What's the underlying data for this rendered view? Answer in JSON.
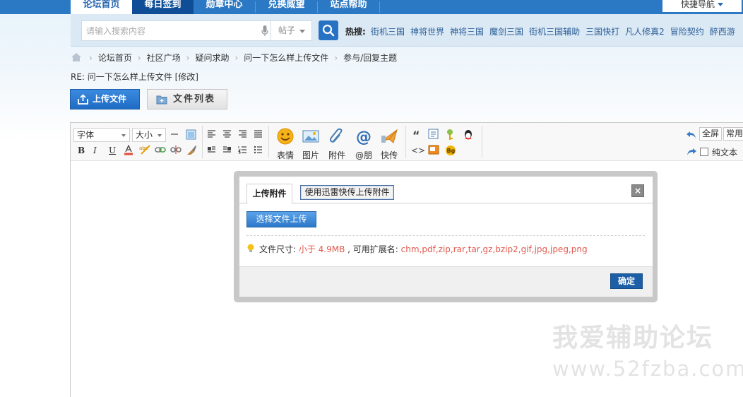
{
  "topnav": {
    "tabs": [
      "论坛首页",
      "每日签到",
      "勋章中心",
      "兑换威望",
      "站点帮助"
    ],
    "quick_nav": "快捷导航"
  },
  "search": {
    "placeholder": "请输入搜索内容",
    "type": "帖子",
    "hot_label": "热搜:",
    "hot_links": [
      "街机三国",
      "神将世界",
      "神将三国",
      "魔剑三国",
      "街机三国辅助",
      "三国快打",
      "凡人修真2",
      "冒险契约",
      "醉西游"
    ]
  },
  "breadcrumb": [
    "论坛首页",
    "社区广场",
    "疑问求助",
    "问一下怎么样上传文件",
    "参与/回复主题"
  ],
  "post_title": "RE: 问一下怎么样上传文件 [修改]",
  "buttons": {
    "upload": "上传文件",
    "file_list": "文件列表"
  },
  "editor": {
    "font_select": "字体",
    "size_select": "大小",
    "big_tools": [
      "表情",
      "图片",
      "附件",
      "@朋",
      "快传"
    ],
    "fullscreen": "全屏",
    "common": "常用",
    "plain_text": "纯文本"
  },
  "dialog": {
    "tab_upload": "上传附件",
    "tab_xunlei": "使用迅雷快传上传附件",
    "choose_button": "选择文件上传",
    "size_label": "文件尺寸: ",
    "size_value": "小于 4.9MB",
    "ext_label": " , 可用扩展名: ",
    "ext_value": "chm,pdf,zip,rar,tar,gz,bzip2,gif,jpg,jpeg,png",
    "ok_button": "确定",
    "close": "×"
  },
  "watermark": {
    "cn": "我爱辅助论坛",
    "url": "www.52fzba.com"
  }
}
